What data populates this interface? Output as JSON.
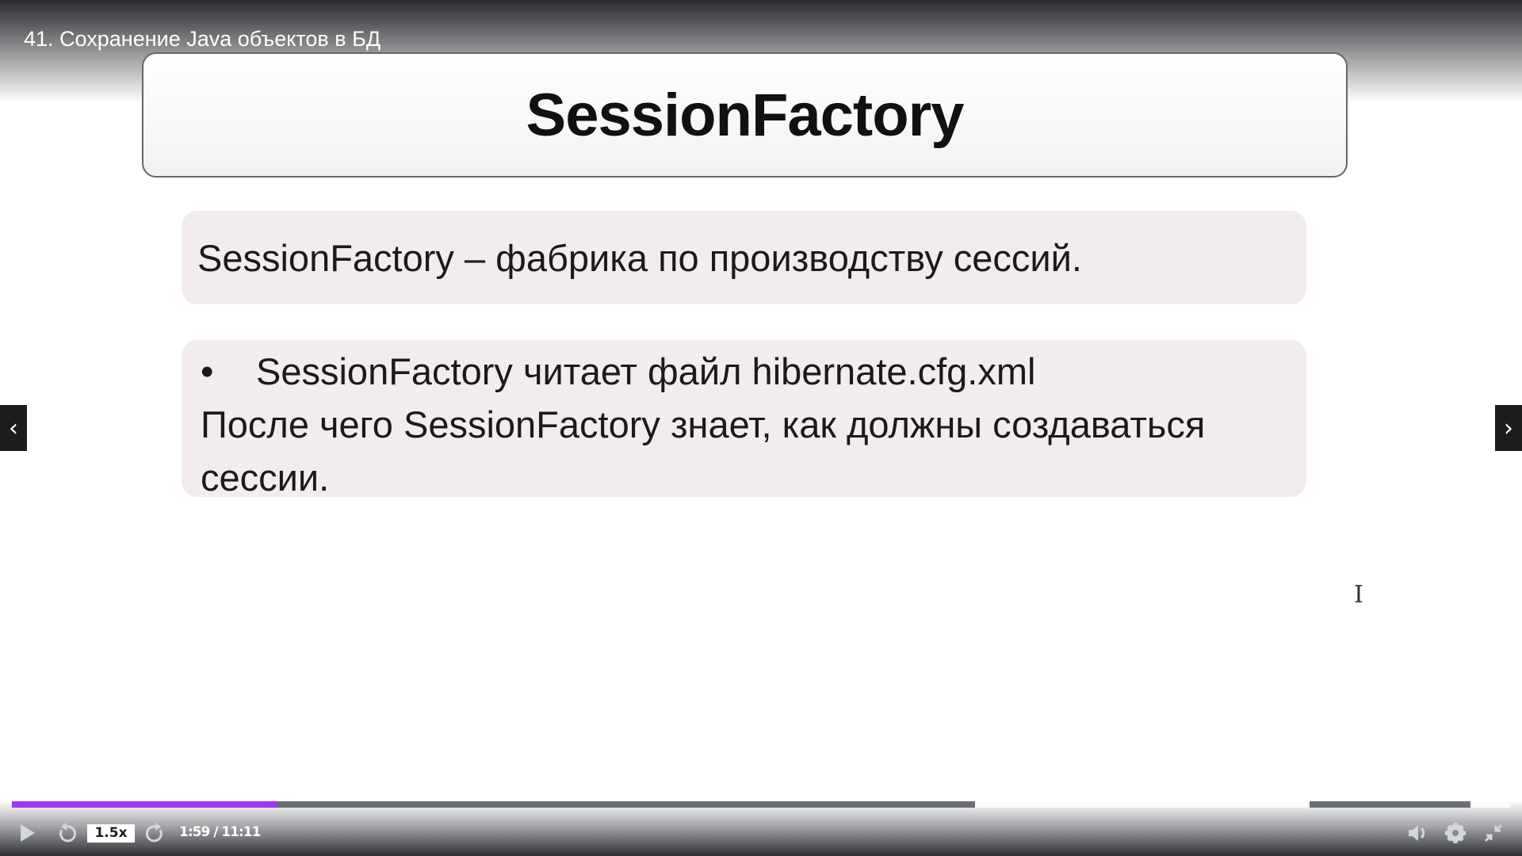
{
  "lecture_title": "41. Сохранение Java объектов в БД",
  "slide": {
    "heading": "SessionFactory",
    "definition": "SessionFactory – фабрика по производству сессий.",
    "bullet_marker": "•",
    "bullet_text": "SessionFactory читает файл hibernate.cfg.xml",
    "continuation_line1": "После чего SessionFactory знает, как должны создаваться",
    "continuation_line2": "сессии."
  },
  "player": {
    "speed": "1.5x",
    "time": "1:59 / 11:11",
    "progress_percent": 17.7,
    "accent_color": "#a435f0",
    "icons": [
      "play-icon",
      "rewind-icon",
      "forward-icon",
      "volume-icon",
      "gear-icon",
      "exit-fullscreen-icon",
      "chevron-left-icon",
      "chevron-right-icon"
    ]
  }
}
